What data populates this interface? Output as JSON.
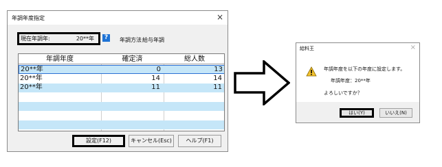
{
  "dialog_year": {
    "title": "年調年度指定",
    "close_glyph": "×",
    "current_year_label": "現在年調年:",
    "current_year_value": "20**年",
    "help_glyph": "?",
    "method_label": "年調方法",
    "method_value": "給与年調",
    "table": {
      "headers": [
        "年調年度",
        "確定済",
        "総人数"
      ],
      "rows": [
        {
          "year": "20**年",
          "confirmed": "0",
          "total": "13"
        },
        {
          "year": "20**年",
          "confirmed": "14",
          "total": "14"
        },
        {
          "year": "20**年",
          "confirmed": "11",
          "total": "11"
        }
      ]
    },
    "buttons": {
      "set": "設定(F12)",
      "cancel": "キャンセル(Esc)",
      "help": "ヘルプ(F1)"
    }
  },
  "dialog_confirm": {
    "title": "給料王",
    "close_glyph": "×",
    "warning_icon": "warning-icon",
    "message_line1": "年調年度を以下の年度に設定します。",
    "message_line2": "年調年度：20**年",
    "message_line3": "よろしいですか？",
    "buttons": {
      "yes": "はい(Y)",
      "no": "いいえ(N)"
    }
  },
  "colors": {
    "selection": "#c5e6f8",
    "focus_border": "#2b6fd3",
    "help_icon": "#1e73d6",
    "warning": "#f2c12e"
  }
}
